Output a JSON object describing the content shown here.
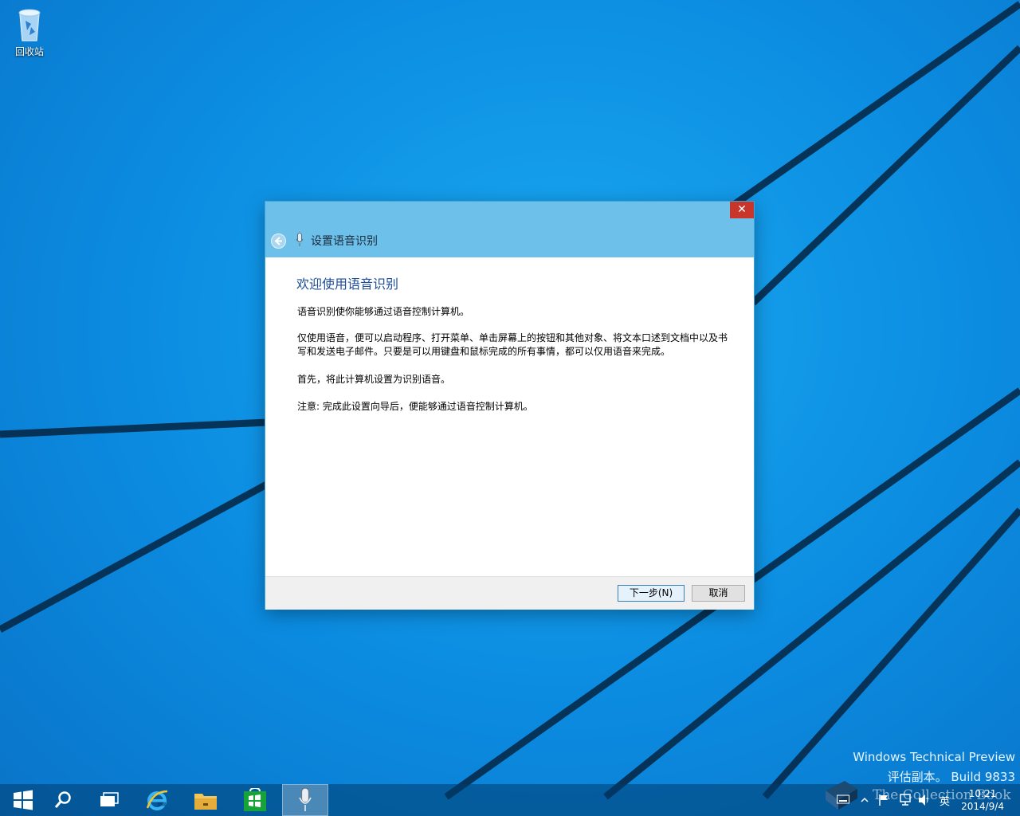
{
  "desktop": {
    "recycle_bin_label": "回收站"
  },
  "dialog": {
    "title": "设置语音识别",
    "close_glyph": "✕",
    "heading": "欢迎使用语音识别",
    "paragraphs": [
      "语音识别使你能够通过语音控制计算机。",
      "仅使用语音，便可以启动程序、打开菜单、单击屏幕上的按钮和其他对象、将文本口述到文档中以及书写和发送电子邮件。只要是可以用键盘和鼠标完成的所有事情，都可以仅用语音来完成。",
      "首先，将此计算机设置为识别语音。",
      "注意: 完成此设置向导后，便能够通过语音控制计算机。"
    ],
    "next_button": "下一步(N)",
    "cancel_button": "取消"
  },
  "watermark": {
    "line1": "Windows Technical Preview",
    "line2": "评估副本。 Build 9833"
  },
  "taskbar": {
    "apps": [
      "start-icon",
      "search-icon",
      "task-view-icon",
      "internet-explorer-icon",
      "file-explorer-icon",
      "store-icon",
      "speech-recognition-icon"
    ],
    "tray_ime": "英",
    "overlay_text": "The Collection Book",
    "clock_time": "10:21",
    "clock_date": "2014/9/4"
  },
  "colors": {
    "desktop_blue": "#0b8be0",
    "dialog_header": "#6dc0ea",
    "close_red": "#c7352b",
    "heading_blue": "#1d4e9a"
  }
}
